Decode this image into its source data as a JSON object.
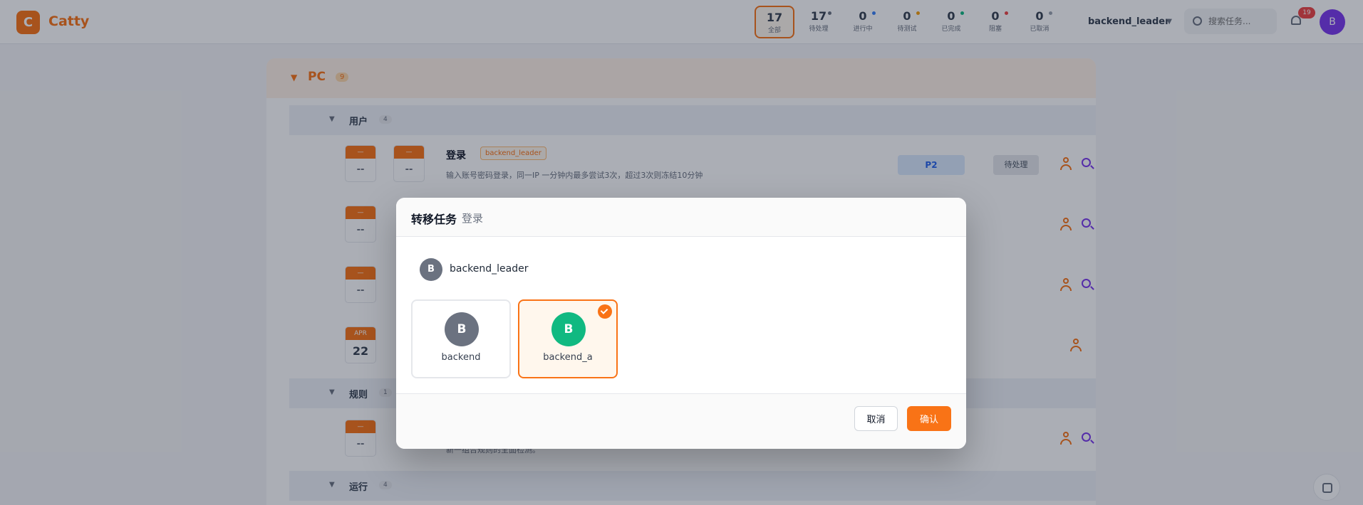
{
  "app": {
    "logo_letter": "C",
    "name": "Catty"
  },
  "stats": [
    {
      "num": "17",
      "label": "全部",
      "dot": ""
    },
    {
      "num": "17",
      "label": "待处理",
      "dot": "#6b7280"
    },
    {
      "num": "0",
      "label": "进行中",
      "dot": "#3b82f6"
    },
    {
      "num": "0",
      "label": "待测试",
      "dot": "#f59e0b"
    },
    {
      "num": "0",
      "label": "已完成",
      "dot": "#10b981"
    },
    {
      "num": "0",
      "label": "阻塞",
      "dot": "#ef4444"
    },
    {
      "num": "0",
      "label": "已取消",
      "dot": "#9ca3af"
    }
  ],
  "header": {
    "project": "backend_leader",
    "search_placeholder": "搜索任务...",
    "notifications": "19",
    "user_initial": "B"
  },
  "board": {
    "group_title": "PC",
    "group_count": "9",
    "sections": [
      {
        "title": "用户",
        "count": "4"
      },
      {
        "title": "规则",
        "count": "1"
      },
      {
        "title": "运行",
        "count": "4"
      }
    ],
    "tasks": [
      {
        "title": "登录",
        "tag": "backend_leader",
        "desc": "输入账号密码登录，同一IP 一分钟内最多尝试3次，超过3次则冻结10分钟",
        "priority": "P2",
        "status": "待处理",
        "cal_top": "—",
        "cal_bot": "--"
      },
      {
        "title": "",
        "tag": "",
        "desc": "",
        "priority": "",
        "status": "",
        "cal_top": "—",
        "cal_bot": "--"
      },
      {
        "title": "",
        "tag": "",
        "desc": "",
        "priority": "",
        "status": "",
        "cal_top": "—",
        "cal_bot": "--"
      },
      {
        "title": "",
        "tag": "",
        "desc": "",
        "priority": "",
        "status": "",
        "cal_top": "APR",
        "cal_bot": "22"
      },
      {
        "title": "",
        "tag": "",
        "desc": "新一组合规则的全面检测。",
        "priority": "",
        "status": "",
        "cal_top": "—",
        "cal_bot": "--"
      }
    ]
  },
  "modal": {
    "title": "转移任务",
    "subtitle": "登录",
    "current_owner": {
      "initial": "B",
      "name": "backend_leader"
    },
    "members": [
      {
        "initial": "B",
        "name": "backend",
        "color": "#6b7280",
        "selected": false
      },
      {
        "initial": "B",
        "name": "backend_a",
        "color": "#10b981",
        "selected": true
      }
    ],
    "cancel_label": "取消",
    "confirm_label": "确认"
  }
}
